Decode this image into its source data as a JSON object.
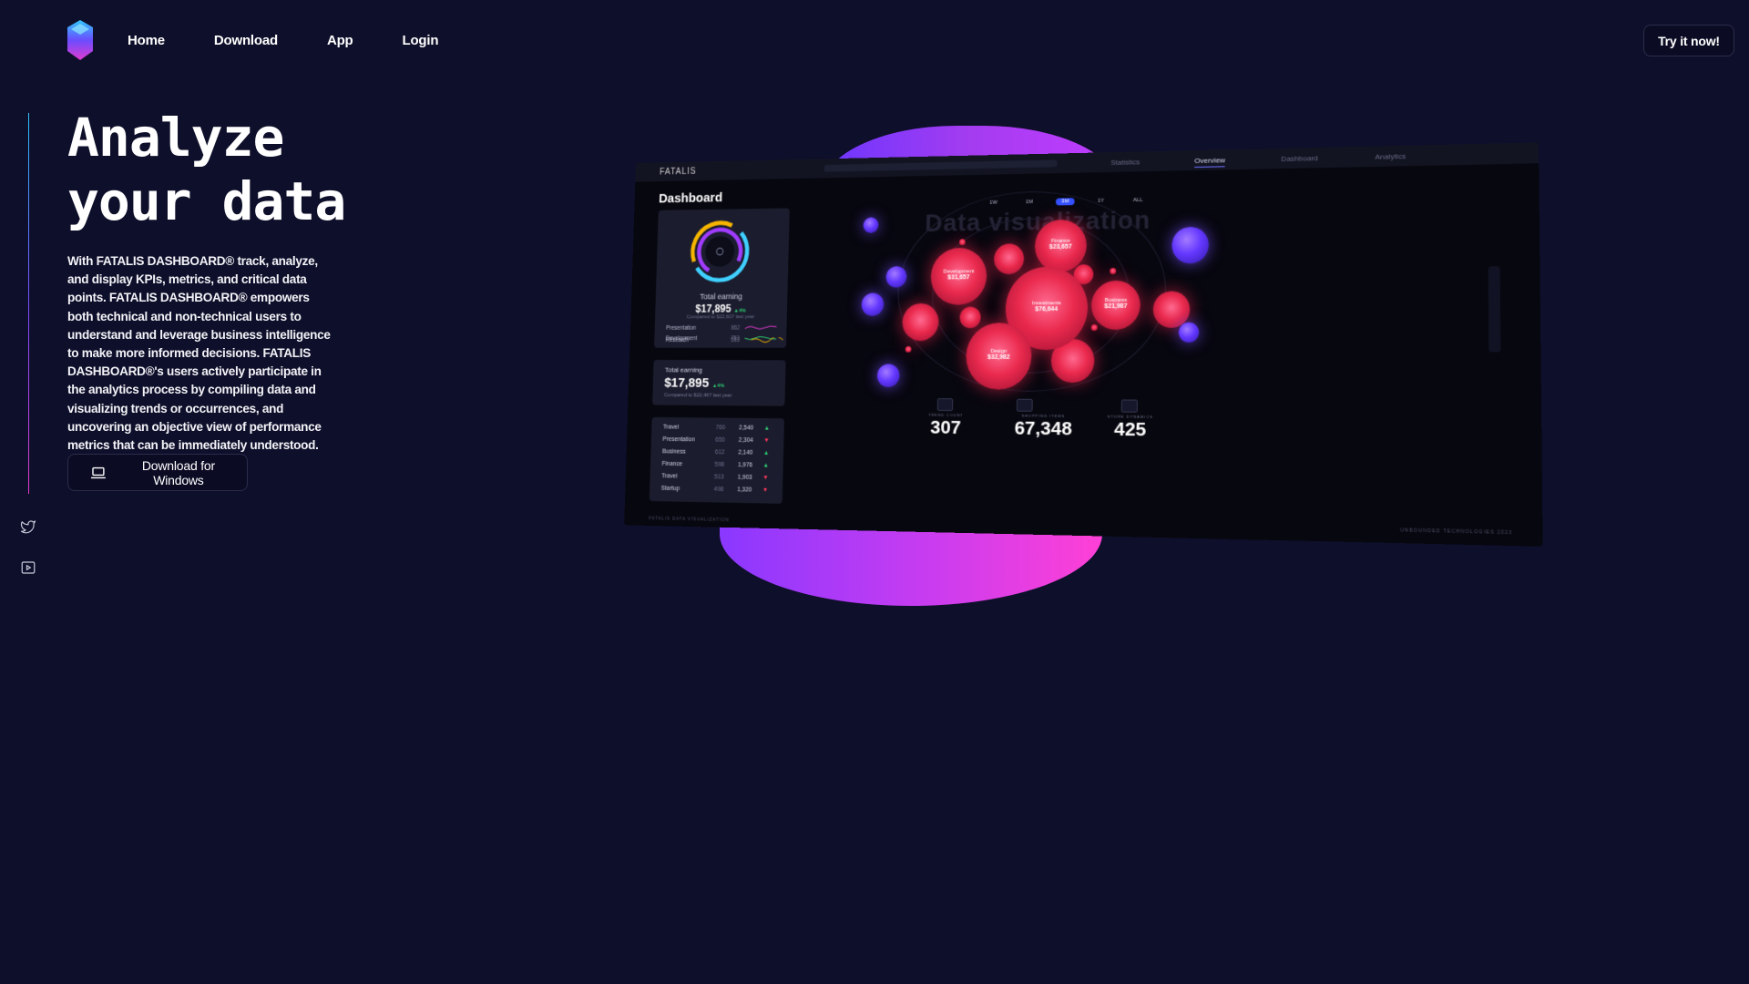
{
  "nav": {
    "items": [
      "Home",
      "Download",
      "App",
      "Login"
    ],
    "cta": "Try it now!"
  },
  "hero": {
    "title_line1": "Analyze",
    "title_line2": "your data",
    "description": "With FATALIS DASHBOARD® track, analyze, and display KPIs, metrics, and critical data points. FATALIS DASHBOARD® empowers both technical and non-technical users to understand and leverage business intelligence to make more informed decisions. FATALIS DASHBOARD®'s users actively participate in the analytics process by compiling data and visualizing trends or occurrences, and uncovering an objective view of performance metrics that can be immediately understood.",
    "download_label": "Download for Windows"
  },
  "social": [
    "twitter-icon",
    "youtube-icon"
  ],
  "preview": {
    "brand": "FATALIS",
    "tabs": [
      "Statistics",
      "Overview",
      "Dashboard",
      "Analytics"
    ],
    "active_tab": "Overview",
    "dashboard_title": "Dashboard",
    "card1": {
      "label": "Total earning",
      "value": "$17,895",
      "change": "▲4%",
      "sub": "Compared to $22,607 last year",
      "rows": [
        {
          "name": "Presentation",
          "n": "862"
        },
        {
          "name": "Development",
          "n": "753"
        },
        {
          "name": "Research",
          "n": "553"
        }
      ]
    },
    "card2": {
      "label": "Total earning",
      "value": "$17,895",
      "change": "▲4%",
      "sub": "Compared to $22,467 last year"
    },
    "table": [
      {
        "name": "Travel",
        "a": "760",
        "b": "2,540",
        "dir": "up"
      },
      {
        "name": "Presentation",
        "a": "650",
        "b": "2,304",
        "dir": "down"
      },
      {
        "name": "Business",
        "a": "612",
        "b": "2,140",
        "dir": "up"
      },
      {
        "name": "Finance",
        "a": "598",
        "b": "1,976",
        "dir": "up"
      },
      {
        "name": "Travel",
        "a": "513",
        "b": "1,903",
        "dir": "down"
      },
      {
        "name": "Startup",
        "a": "498",
        "b": "1,320",
        "dir": "down"
      }
    ],
    "viz_title": "Data visualization",
    "ranges": [
      "1W",
      "1M",
      "3M",
      "1Y",
      "ALL"
    ],
    "active_range": "3M",
    "bubbles": [
      {
        "name": "Finance",
        "value": "$23,657"
      },
      {
        "name": "Development",
        "value": "$31,657"
      },
      {
        "name": "Investments",
        "value": "$76,644"
      },
      {
        "name": "Business",
        "value": "$21,987"
      },
      {
        "name": "Design",
        "value": "$32,982"
      }
    ],
    "stats": [
      {
        "caption": "TREND COUNT",
        "value": "307"
      },
      {
        "caption": "SHOPPING ITEMS",
        "value": "67,348"
      },
      {
        "caption": "STORE DYNAMICS",
        "value": "425"
      }
    ],
    "footer_left": "FATALIS DATA VISUALIZATION",
    "footer_right": "UNBOUNDED TECHNOLOGIES 2023",
    "colors": {
      "up": "#2ecc71",
      "down": "#ff3b5c",
      "accent": "#3450ff"
    }
  }
}
